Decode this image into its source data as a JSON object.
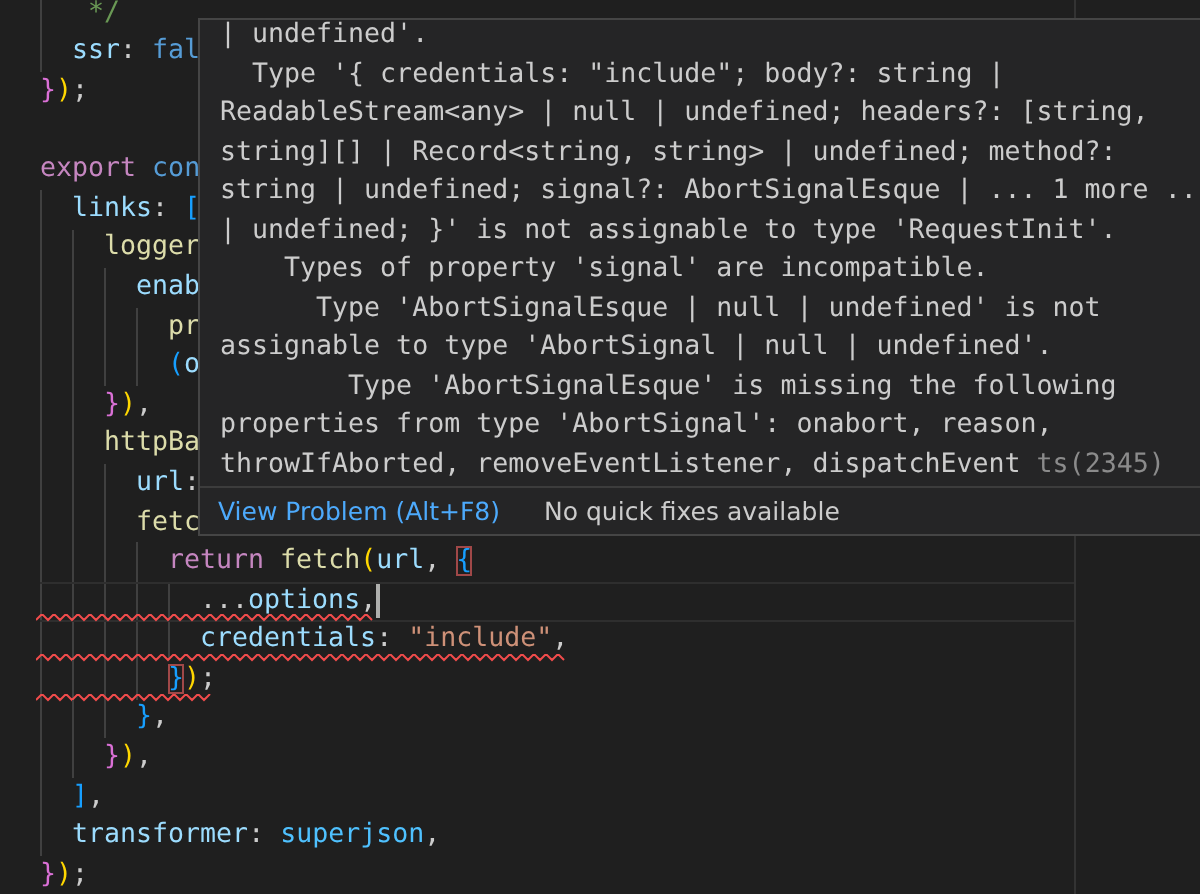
{
  "editor": {
    "lines": [
      {
        "children": [
          {
            "tokens": [
              {
                "text": " */",
                "kind": "comment"
              }
            ]
          },
          {
            "tokens": [
              {
                "text": "ssr",
                "kind": "prop"
              },
              {
                "text": ": ",
                "kind": "punct"
              },
              {
                "text": "fal",
                "kind": "keyword"
              }
            ]
          }
        ]
      },
      {
        "tokens": [
          {
            "text": "}",
            "kind": "pink"
          },
          {
            "text": ")",
            "kind": "gold"
          },
          {
            "text": ";",
            "kind": "punct"
          }
        ]
      },
      {
        "kind": "blank"
      },
      {
        "tokens": [
          {
            "text": "export",
            "kind": "control"
          },
          {
            "text": " con",
            "kind": "keyword"
          }
        ],
        "children": [
          {
            "tokens": [
              {
                "text": "links",
                "kind": "prop"
              },
              {
                "text": ": ",
                "kind": "punct"
              },
              {
                "text": "[",
                "kind": "blue"
              }
            ],
            "children": [
              {
                "tokens": [
                  {
                    "text": "logger",
                    "kind": "func"
                  }
                ],
                "children": [
                  {
                    "tokens": [
                      {
                        "text": "enab",
                        "kind": "prop"
                      }
                    ],
                    "children": [
                      {
                        "tokens": [
                          {
                            "text": "pr",
                            "kind": "func"
                          }
                        ]
                      },
                      {
                        "tokens": [
                          {
                            "text": "(",
                            "kind": "blue"
                          },
                          {
                            "text": "o",
                            "kind": "prop"
                          }
                        ]
                      }
                    ]
                  }
                ]
              },
              {
                "tokens": [
                  {
                    "text": "}",
                    "kind": "pink"
                  },
                  {
                    "text": ")",
                    "kind": "gold"
                  },
                  {
                    "text": ",",
                    "kind": "punct"
                  }
                ]
              },
              {
                "tokens": [
                  {
                    "text": "httpBa",
                    "kind": "func"
                  }
                ],
                "children": [
                  {
                    "tokens": [
                      {
                        "text": "url",
                        "kind": "prop"
                      },
                      {
                        "text": ":",
                        "kind": "punct"
                      }
                    ]
                  },
                  {
                    "tokens": [
                      {
                        "text": "fetc",
                        "kind": "func"
                      }
                    ],
                    "children": [
                      {
                        "tokens": [
                          {
                            "text": "return",
                            "kind": "control"
                          },
                          {
                            "text": " fetch",
                            "kind": "func"
                          },
                          {
                            "text": "(",
                            "kind": "gold"
                          },
                          {
                            "text": "url",
                            "kind": "prop"
                          },
                          {
                            "text": ", ",
                            "kind": "punct"
                          },
                          {
                            "text": "{",
                            "kind": "blue",
                            "matched": true
                          }
                        ],
                        "children": [
                          {
                            "current": true,
                            "cursor": true,
                            "error": true,
                            "tokens": [
                              {
                                "text": "...",
                                "kind": "punct"
                              },
                              {
                                "text": "options",
                                "kind": "prop"
                              },
                              {
                                "text": ",",
                                "kind": "punct"
                              }
                            ]
                          },
                          {
                            "error": true,
                            "tokens": [
                              {
                                "text": "credentials",
                                "kind": "prop"
                              },
                              {
                                "text": ": ",
                                "kind": "punct"
                              },
                              {
                                "text": "\"include\"",
                                "kind": "string"
                              },
                              {
                                "text": ",",
                                "kind": "punct"
                              }
                            ]
                          }
                        ]
                      },
                      {
                        "error": true,
                        "tokens": [
                          {
                            "text": "}",
                            "kind": "blue",
                            "matched": true
                          },
                          {
                            "text": ")",
                            "kind": "gold"
                          },
                          {
                            "text": ";",
                            "kind": "punct"
                          }
                        ]
                      }
                    ]
                  },
                  {
                    "tokens": [
                      {
                        "text": "}",
                        "kind": "blue"
                      },
                      {
                        "text": ",",
                        "kind": "punct"
                      }
                    ]
                  }
                ]
              },
              {
                "tokens": [
                  {
                    "text": "}",
                    "kind": "pink"
                  },
                  {
                    "text": ")",
                    "kind": "gold"
                  },
                  {
                    "text": ",",
                    "kind": "punct"
                  }
                ]
              }
            ]
          },
          {
            "tokens": [
              {
                "text": "]",
                "kind": "blue"
              },
              {
                "text": ",",
                "kind": "punct"
              }
            ]
          },
          {
            "tokens": [
              {
                "text": "transformer",
                "kind": "prop"
              },
              {
                "text": ": ",
                "kind": "punct"
              },
              {
                "text": "superjson",
                "kind": "var"
              },
              {
                "text": ",",
                "kind": "punct"
              }
            ]
          }
        ]
      },
      {
        "tokens": [
          {
            "text": "}",
            "kind": "pink"
          },
          {
            "text": ")",
            "kind": "gold"
          },
          {
            "text": ";",
            "kind": "punct"
          }
        ]
      }
    ]
  },
  "hover": {
    "message_lines": [
      "| undefined'.",
      "  Type '{ credentials: \"include\"; body?: string |",
      "ReadableStream<any> | null | undefined; headers?: [string,",
      "string][] | Record<string, string> | undefined; method?:",
      "string | undefined; signal?: AbortSignalEsque | ... 1 more ..",
      "| undefined; }' is not assignable to type 'RequestInit'.",
      "    Types of property 'signal' are incompatible.",
      "      Type 'AbortSignalEsque | null | undefined' is not",
      "assignable to type 'AbortSignal | null | undefined'.",
      "        Type 'AbortSignalEsque' is missing the following",
      "properties from type 'AbortSignal': onabort, reason,",
      "throwIfAborted, removeEventListener, dispatchEvent"
    ],
    "error_code": "ts(2345)",
    "view_problem": "View Problem (Alt+F8)",
    "quick_fix_note": "No quick fixes available"
  }
}
